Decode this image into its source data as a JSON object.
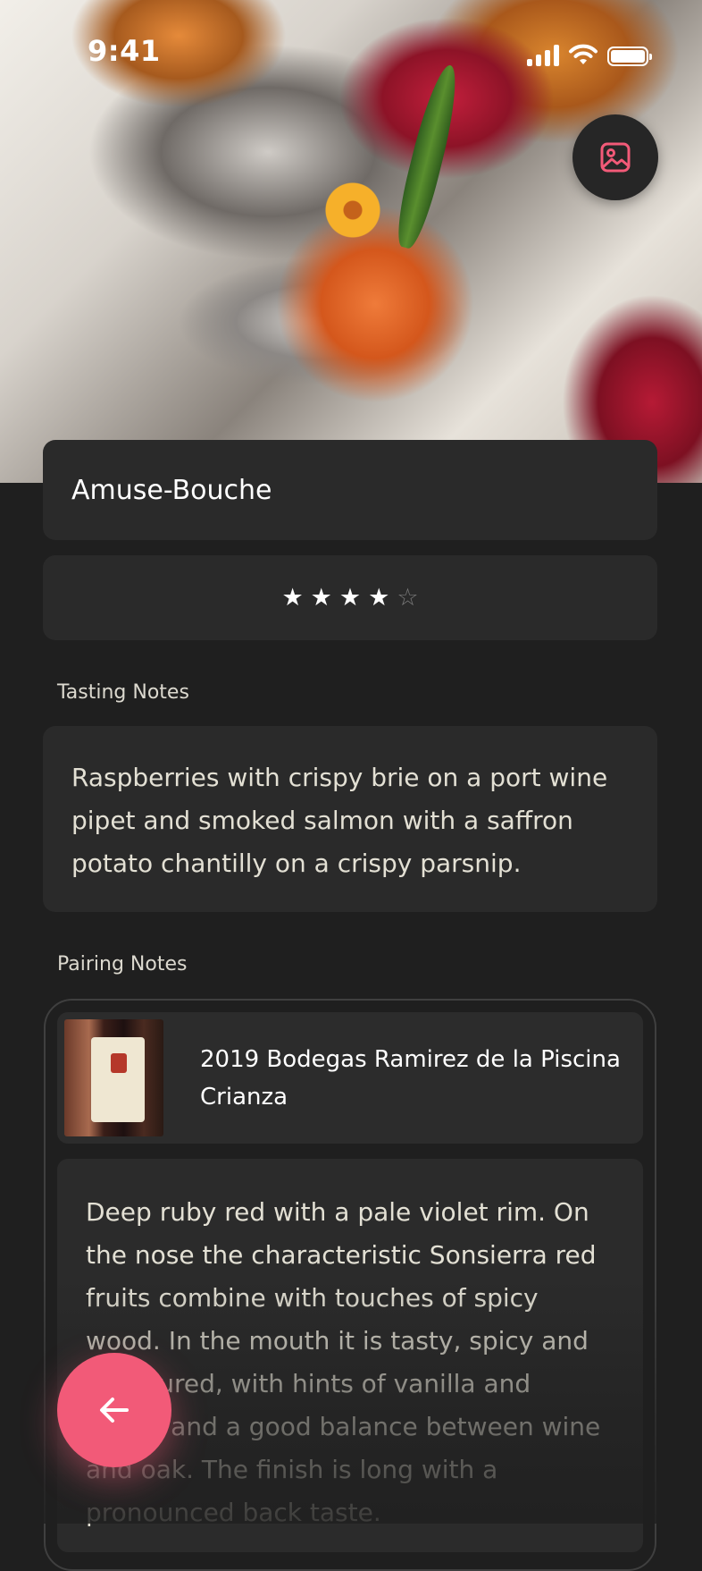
{
  "status_bar": {
    "time": "9:41"
  },
  "dish": {
    "title": "Amuse-Bouche",
    "rating": 4,
    "rating_max": 5
  },
  "tasting": {
    "label": "Tasting Notes",
    "text": "Raspberries with crispy brie on a port wine pipet and smoked salmon with a saffron potato chantilly on a crispy parsnip."
  },
  "pairing": {
    "label": "Pairing Notes",
    "wine_name": "2019 Bodegas Ramirez de la Piscina Crianza",
    "wine_notes": "Deep ruby red with a pale violet rim. On the nose the characteristic Sonsierra red fruits combine with touches of spicy wood. In the mouth it is tasty, spicy and structured, with hints of vanilla and coffee and a good balance between wine and oak. The finish is long with a pronounced back taste."
  },
  "colors": {
    "accent": "#f25a78",
    "background": "#1f1f1f",
    "card": "#2a2a2a"
  },
  "icons": {
    "photo_button": "image-icon",
    "back_button": "arrow-left-icon"
  }
}
